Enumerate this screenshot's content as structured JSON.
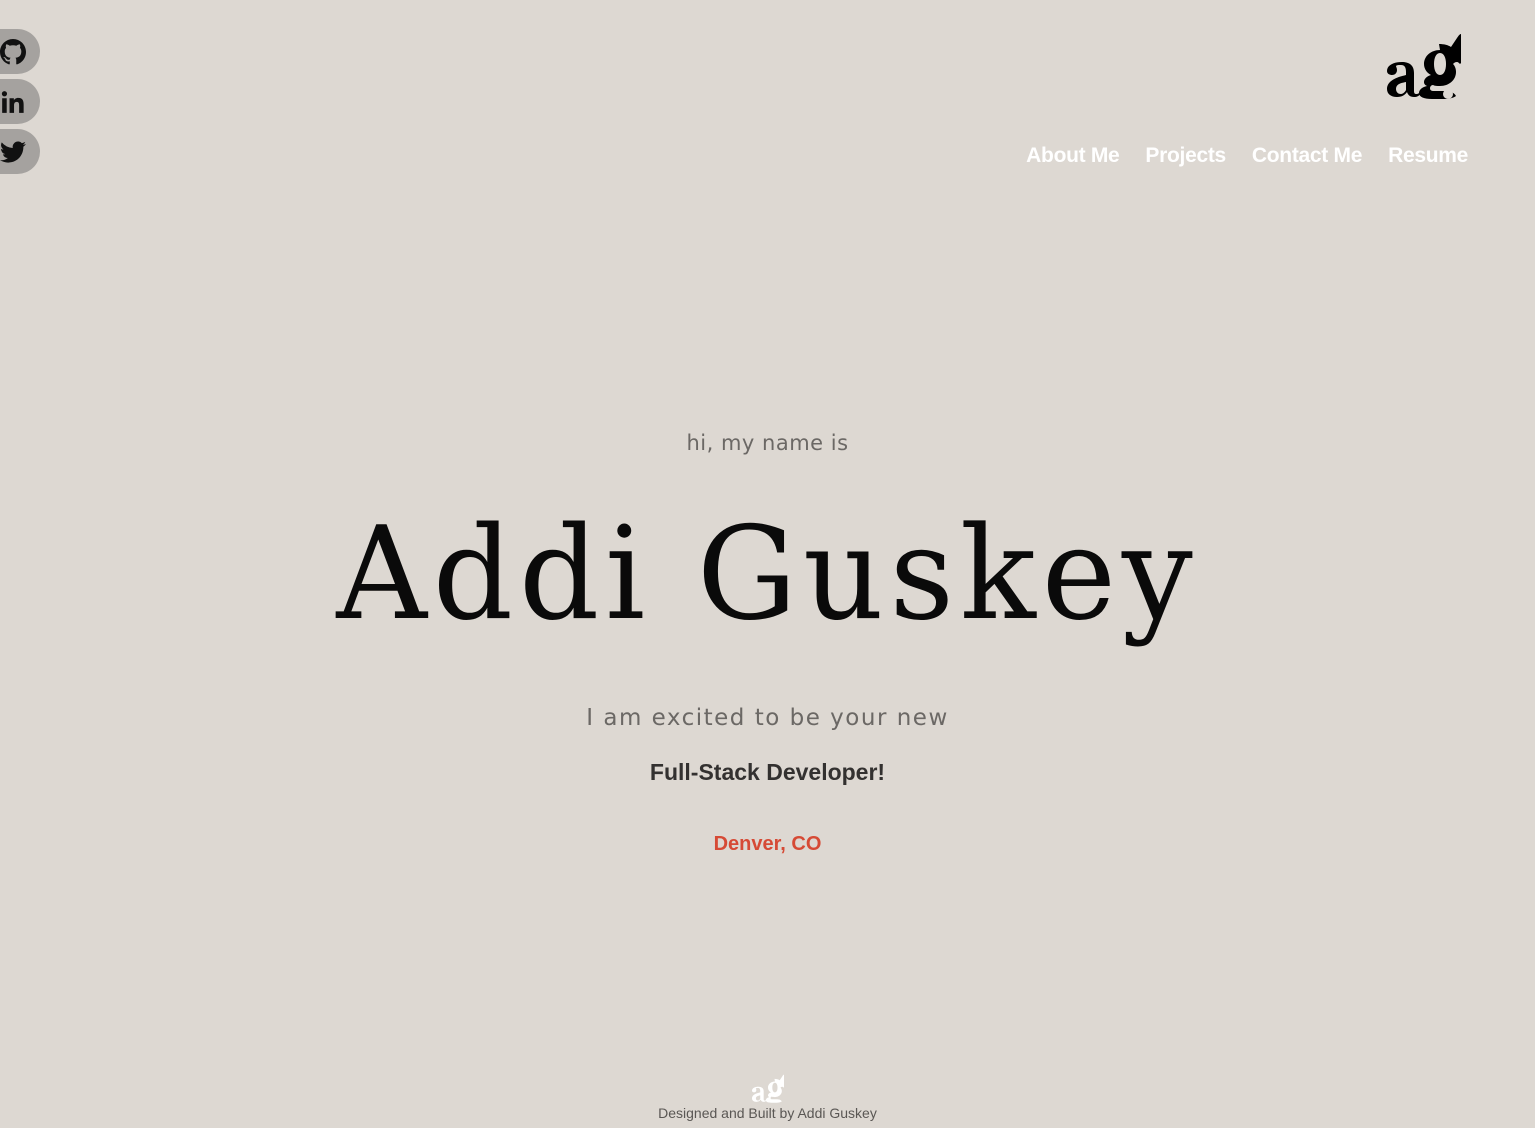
{
  "social": [
    {
      "name": "github",
      "icon": "github-icon"
    },
    {
      "name": "linkedin",
      "icon": "linkedin-icon"
    },
    {
      "name": "twitter",
      "icon": "twitter-icon"
    }
  ],
  "logo": {
    "icon": "ag-monogram-logo"
  },
  "nav": {
    "items": [
      {
        "label": "About Me"
      },
      {
        "label": "Projects"
      },
      {
        "label": "Contact Me"
      },
      {
        "label": "Resume"
      }
    ]
  },
  "hero": {
    "intro": "hi, my name is",
    "name": "Addi Guskey",
    "tagline": "I am excited to be your new",
    "role": "Full-Stack Developer!",
    "location": "Denver, CO"
  },
  "footer": {
    "credit": "Designed and Built by Addi Guskey"
  },
  "colors": {
    "background": "#ddd8d2",
    "nav_text": "#ffffff",
    "accent": "#d64a35",
    "social_bg": "#a5a29f"
  }
}
